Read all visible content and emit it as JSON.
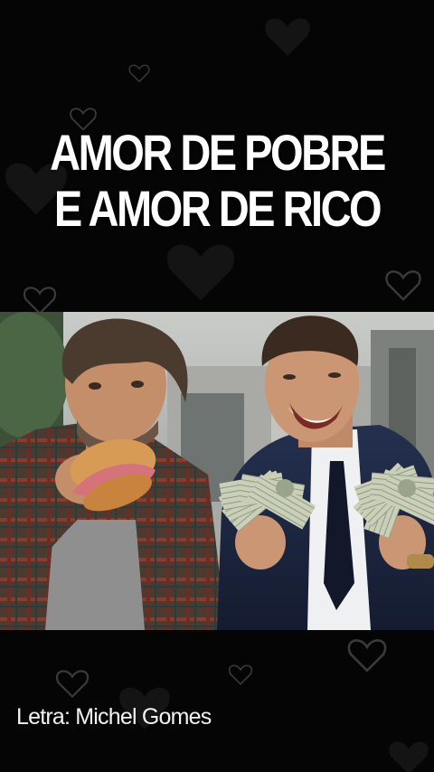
{
  "title": {
    "line1": "AMOR DE POBRE",
    "line2": "E AMOR DE RICO"
  },
  "photo": {
    "left_subject": "man-eating-sandwich",
    "right_subject": "man-holding-money"
  },
  "credit": {
    "text": "Letra: Michel Gomes"
  },
  "colors": {
    "background": "#050505",
    "title": "#ffffff",
    "heart_outline": "#2a2a2a"
  }
}
